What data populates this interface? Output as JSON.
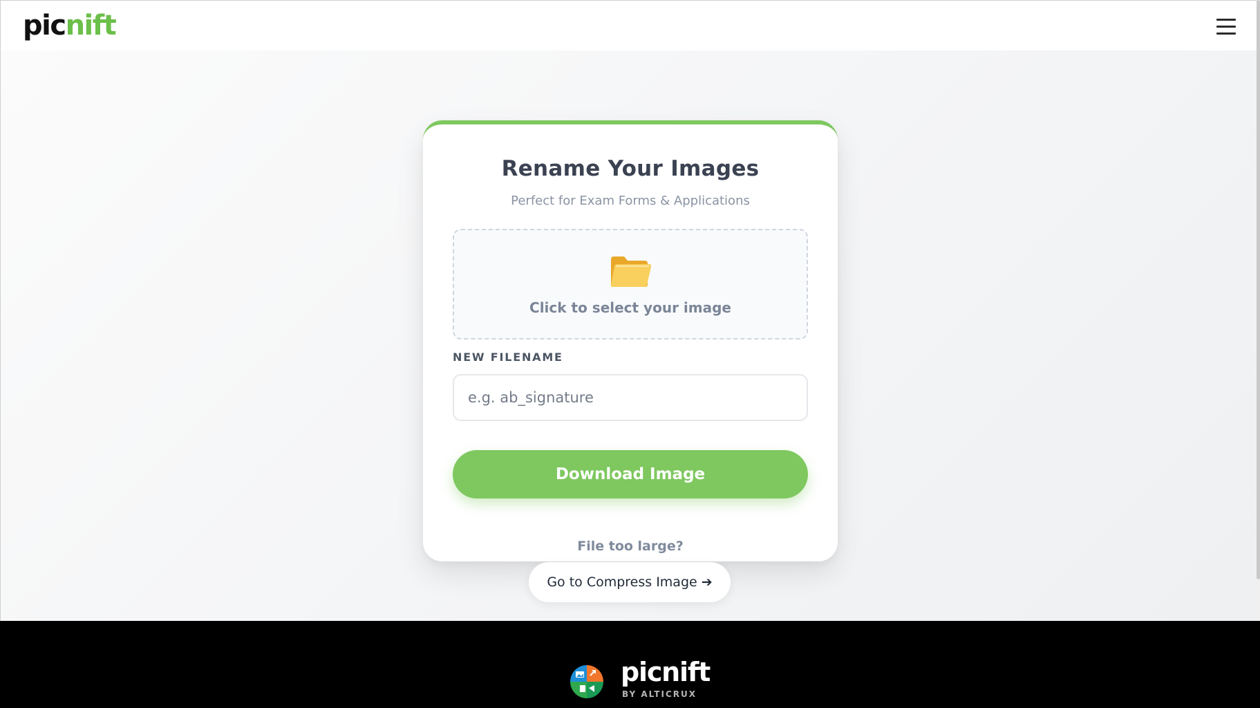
{
  "header": {
    "logo_part1": "pic",
    "logo_part2": "nift",
    "menu_icon": "hamburger-menu-icon"
  },
  "card": {
    "title": "Rename Your Images",
    "subtitle": "Perfect for Exam Forms & Applications",
    "dropzone": {
      "icon": "folder-icon",
      "text": "Click to select your image"
    },
    "filename_label": "NEW FILENAME",
    "filename_placeholder": "e.g. ab_signature",
    "download_label": "Download Image"
  },
  "compress": {
    "prompt": "File too large?",
    "button_label": "Go to Compress Image ➔"
  },
  "footer": {
    "brand": "picnift",
    "byline": "BY ALTICRUX"
  },
  "colors": {
    "accent": "#7ec85f",
    "logo_green": "#6cbf4a",
    "footer_bg": "#000000"
  }
}
